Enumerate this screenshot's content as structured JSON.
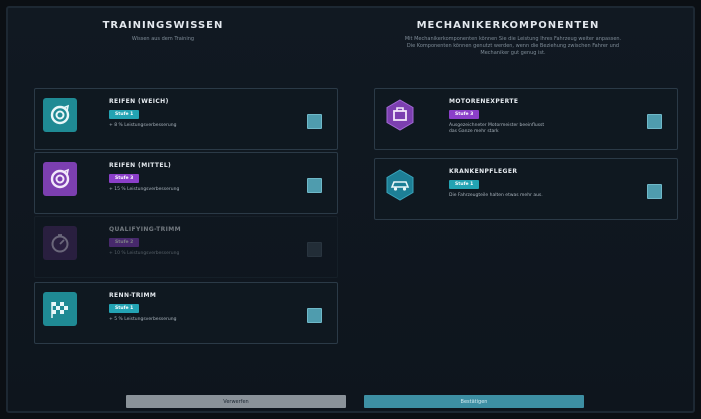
{
  "left_column": {
    "title": "TRAININGSWISSEN",
    "subtitle": "Wissen aus dem Training"
  },
  "right_column": {
    "title": "MECHANIKERKOMPONENTEN",
    "subtitle_line1": "Mit Mechanikerkomponenten können Sie die Leistung Ihres Fahrzeug weiter anpassen.",
    "subtitle_line2": "Die Komponenten können genutzt werden, wenn die Beziehung zwischen Fahrer und",
    "subtitle_line3": "Mechaniker gut genug ist."
  },
  "training_cards": [
    {
      "title": "REIFEN (WEICH)",
      "badge": "Stufe 1",
      "desc": "+ 8 % Leistungsverbesserung",
      "icon": "tire-target-icon",
      "badge_color": "#23a3b3"
    },
    {
      "title": "REIFEN (MITTEL)",
      "badge": "Stufe 3",
      "desc": "+ 15 % Leistungsverbesserung",
      "icon": "tire-target-icon",
      "badge_color": "#8b3fc9"
    },
    {
      "title": "QUALIFYING-TRIMM",
      "badge": "Stufe 2",
      "desc": "+ 10 % Leistungsverbesserung",
      "icon": "stopwatch-icon",
      "badge_color": "#8b3fc9"
    },
    {
      "title": "RENN-TRIMM",
      "badge": "Stufe 1",
      "desc": "+ 5 % Leistungsverbesserung",
      "icon": "race-flag-icon",
      "badge_color": "#23a3b3"
    }
  ],
  "mechanic_cards": [
    {
      "title": "MOTORENEXPERTE",
      "badge": "Stufe 3",
      "desc_line1": "Ausgezeichneter Motormeister beeinflusst",
      "desc_line2": "das Ganze mehr stark",
      "icon": "engine-icon"
    },
    {
      "title": "KRANKENPFLEGER",
      "badge": "Stufe 1",
      "desc_line1": "Die Fahrzeugteile halten etwas mehr aus.",
      "desc_line2": "",
      "icon": "car-repair-icon"
    }
  ],
  "buttons": {
    "cancel": "Verwerfen",
    "confirm": "Bestätigen"
  },
  "colors": {
    "accent_teal": "#23a3b3",
    "accent_purple": "#8b3fc9",
    "background": "#0b0f14"
  }
}
